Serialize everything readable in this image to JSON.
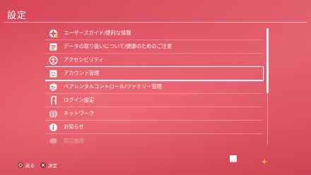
{
  "screen": {
    "title": "設定"
  },
  "menu": {
    "items": [
      {
        "label": "ユーザーズガイド/便利な情報",
        "icon": "guide-icon"
      },
      {
        "label": "データの取り扱いについて/健康のためのご注意",
        "icon": "notice-icon"
      },
      {
        "label": "アクセシビリティ",
        "icon": "accessibility-icon"
      },
      {
        "label": "アカウント管理",
        "icon": "account-icon"
      },
      {
        "label": "ペアレンタルコントロール/ファミリー管理",
        "icon": "parental-control-icon"
      },
      {
        "label": "ログイン設定",
        "icon": "login-icon"
      },
      {
        "label": "ネットワーク",
        "icon": "network-icon"
      },
      {
        "label": "お知らせ",
        "icon": "info-icon"
      },
      {
        "label": "周辺機器",
        "icon": "devices-icon"
      }
    ],
    "selected_index": 3
  },
  "footer": {
    "back_label": "戻る",
    "confirm_label": "決定"
  },
  "colors": {
    "background": "#e05565",
    "accent": "#ffffff",
    "star": "#f0b83a"
  }
}
